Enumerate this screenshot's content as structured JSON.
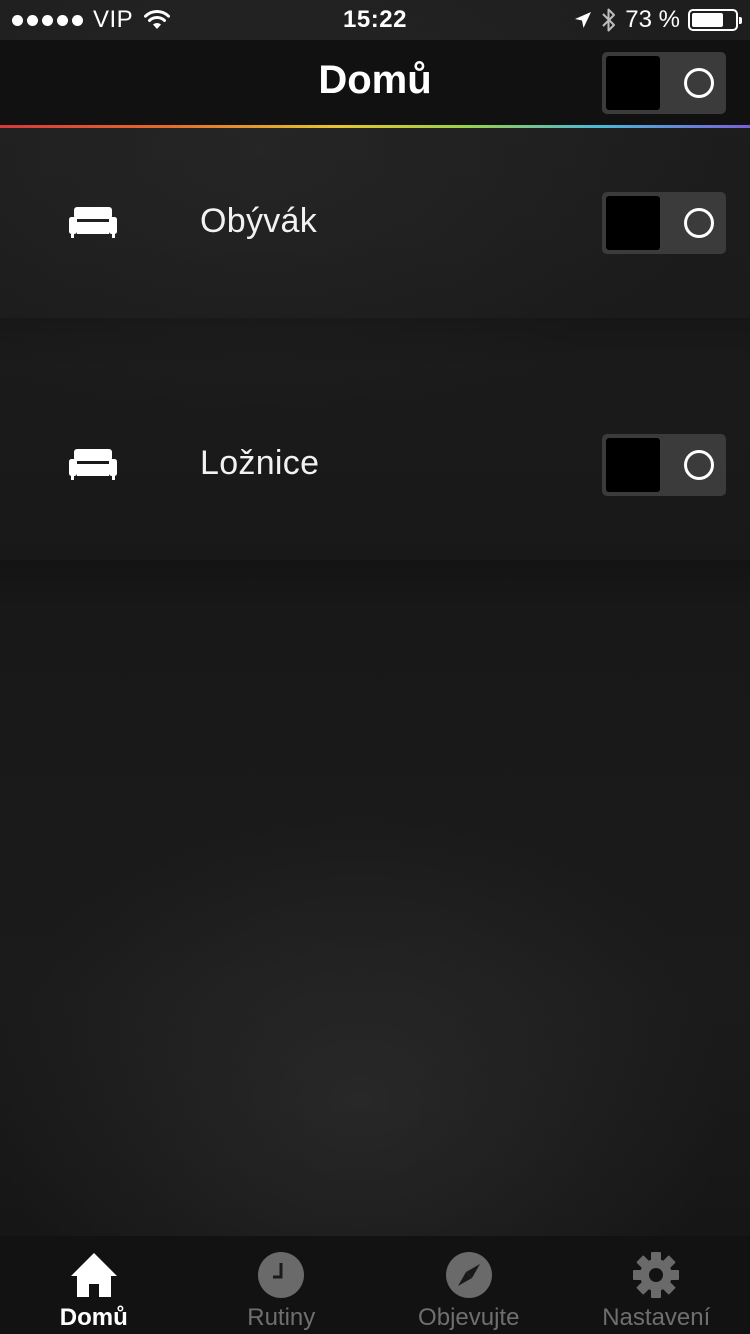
{
  "status_bar": {
    "carrier": "VIP",
    "time": "15:22",
    "battery_text": "73 %",
    "battery_level": 0.73,
    "signal_icon": "signal-dots-icon",
    "wifi_icon": "wifi-icon",
    "location_icon": "location-arrow-icon",
    "bluetooth_icon": "bluetooth-icon"
  },
  "header": {
    "title": "Domů",
    "master_toggle": {
      "state": "off"
    }
  },
  "rooms": [
    {
      "label": "Obývák",
      "icon": "sofa-icon",
      "toggle": "off"
    },
    {
      "label": "Ložnice",
      "icon": "sofa-icon",
      "toggle": "off"
    }
  ],
  "tabbar": {
    "tabs": [
      {
        "label": "Domů",
        "icon": "home-icon",
        "active": true
      },
      {
        "label": "Rutiny",
        "icon": "clock-icon",
        "active": false
      },
      {
        "label": "Objevujte",
        "icon": "compass-icon",
        "active": false
      },
      {
        "label": "Nastavení",
        "icon": "gear-icon",
        "active": false
      }
    ]
  },
  "colors": {
    "background": "#1a1a1a",
    "toggle_track": "#3b3b3b",
    "inactive_tab": "#6f6f6f",
    "active_tab": "#ffffff"
  }
}
